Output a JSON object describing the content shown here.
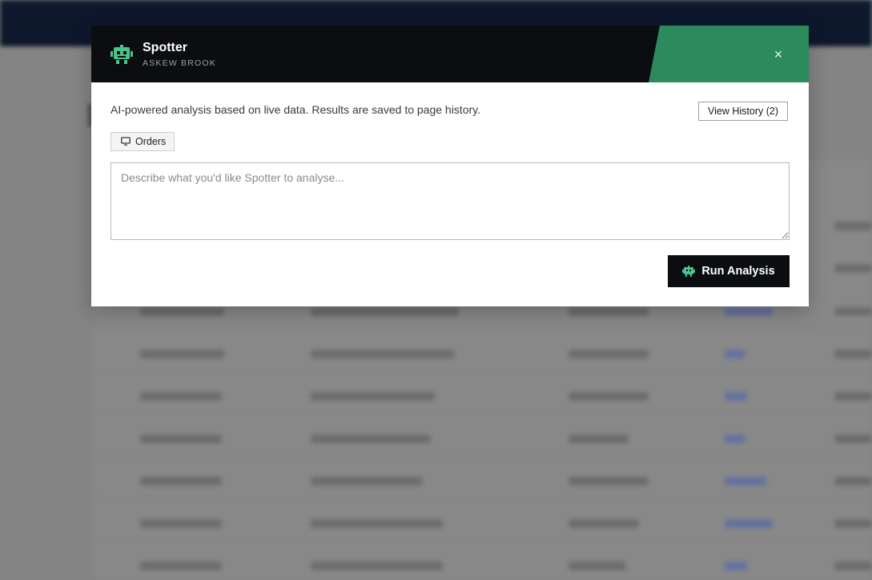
{
  "modal": {
    "title": "Spotter",
    "subtitle": "ASKEW BROOK",
    "description": "AI-powered analysis based on live data. Results are saved to page history.",
    "history_button": "View History (2)",
    "context_chip": "Orders",
    "prompt_placeholder": "Describe what you'd like Spotter to analyse...",
    "prompt_value": "",
    "run_button": "Run Analysis",
    "close_label": "×"
  },
  "colors": {
    "header_bg": "#0b0d10",
    "accent": "#2d8a5c",
    "robot_icon": "#4cc38a"
  },
  "icons": {
    "header": "robot-icon",
    "close": "close-icon",
    "chip": "monitor-icon",
    "run": "robot-icon"
  }
}
